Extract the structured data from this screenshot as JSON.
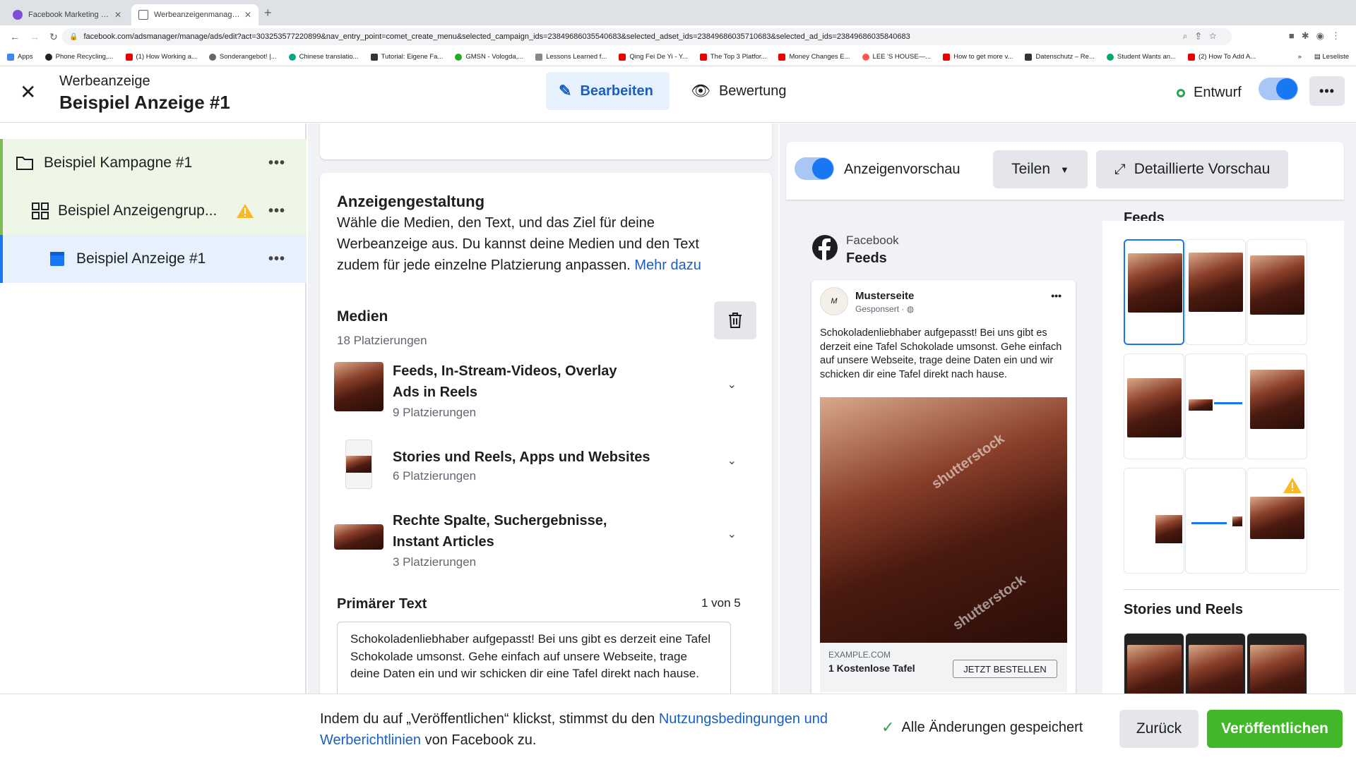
{
  "browser": {
    "tabs": [
      {
        "title": "Facebook Marketing & Werbea"
      },
      {
        "title": "Werbeanzeigenmanager - Wer"
      }
    ],
    "url": "facebook.com/adsmanager/manage/ads/edit?act=303253577220899&nav_entry_point=comet_create_menu&selected_campaign_ids=23849686035540683&selected_adset_ids=23849686035710683&selected_ad_ids=23849686035840683",
    "bookmarks": [
      "Apps",
      "Phone Recycling,...",
      "(1) How Working a...",
      "Sonderangebot! |...",
      "Chinese translatio...",
      "Tutorial: Eigene Fa...",
      "GMSN - Vologda,...",
      "Lessons Learned f...",
      "Qing Fei De Yi - Y...",
      "The Top 3 Platfor...",
      "Money Changes E...",
      "LEE 'S HOUSE—...",
      "How to get more v...",
      "Datenschutz – Re...",
      "Student Wants an...",
      "(2) How To Add A..."
    ],
    "reading_list": "Leseliste",
    "more": "»"
  },
  "header": {
    "subtitle": "Werbeanzeige",
    "title": "Beispiel Anzeige #1",
    "edit_label": "Bearbeiten",
    "review_label": "Bewertung",
    "status_label": "Entwurf"
  },
  "tree": {
    "campaign": "Beispiel Kampagne #1",
    "adset": "Beispiel Anzeigengrup...",
    "ad": "Beispiel Anzeige #1"
  },
  "creative": {
    "title": "Anzeigengestaltung",
    "description": "Wähle die Medien, den Text, und das Ziel für deine Werbeanzeige aus. Du kannst deine Medien und den Text zudem für jede einzelne Platzierung anpassen.",
    "more_link": "Mehr dazu",
    "media_title": "Medien",
    "media_count": "18 Platzierungen",
    "placements": [
      {
        "title_line1": "Feeds, In-Stream-Videos, Overlay",
        "title_line2": "Ads in Reels",
        "count": "9 Platzierungen"
      },
      {
        "title_line1": "Stories und Reels, Apps und Websites",
        "title_line2": "",
        "count": "6 Platzierungen"
      },
      {
        "title_line1": "Rechte Spalte, Suchergebnisse,",
        "title_line2": "Instant Articles",
        "count": "3 Platzierungen"
      }
    ],
    "primary_text_label": "Primärer Text",
    "primary_text_counter": "1 von 5",
    "primary_text_value": "Schokoladenliebhaber aufgepasst! Bei uns gibt es derzeit eine Tafel Schokolade umsonst. Gehe einfach auf unsere Webseite, trage deine Daten ein und wir schicken dir eine Tafel direkt nach hause."
  },
  "preview": {
    "toggle_label": "Anzeigenvorschau",
    "share_label": "Teilen",
    "detailed_label": "Detaillierte Vorschau",
    "platform": "Facebook",
    "placement": "Feeds",
    "page_name": "Musterseite",
    "sponsored": "Gesponsert · ",
    "post_text": "Schokoladenliebhaber aufgepasst! Bei uns gibt es derzeit eine Tafel Schokolade umsonst. Gehe einfach auf unsere Webseite, trage deine Daten ein und wir schicken dir eine Tafel direkt nach hause.",
    "domain": "EXAMPLE.COM",
    "headline": "1 Kostenlose Tafel",
    "cta": "JETZT BESTELLEN",
    "watermark": "shutterstock",
    "feeds_heading": "Feeds",
    "stories_heading": "Stories und Reels"
  },
  "footer": {
    "terms_before": "Indem du auf „Veröffentlichen“ klickst, stimmst du den ",
    "terms_link": "Nutzungsbedingungen und Werberichtlinien",
    "terms_after": " von Facebook zu.",
    "saved": "Alle Änderungen gespeichert",
    "back": "Zurück",
    "publish": "Veröffentlichen"
  },
  "colors": {
    "accent": "#1877f2",
    "publish_green": "#42b72a",
    "warning": "#f7b928",
    "tree_green": "#eef6e6",
    "tree_blue": "#e7f0fd"
  }
}
